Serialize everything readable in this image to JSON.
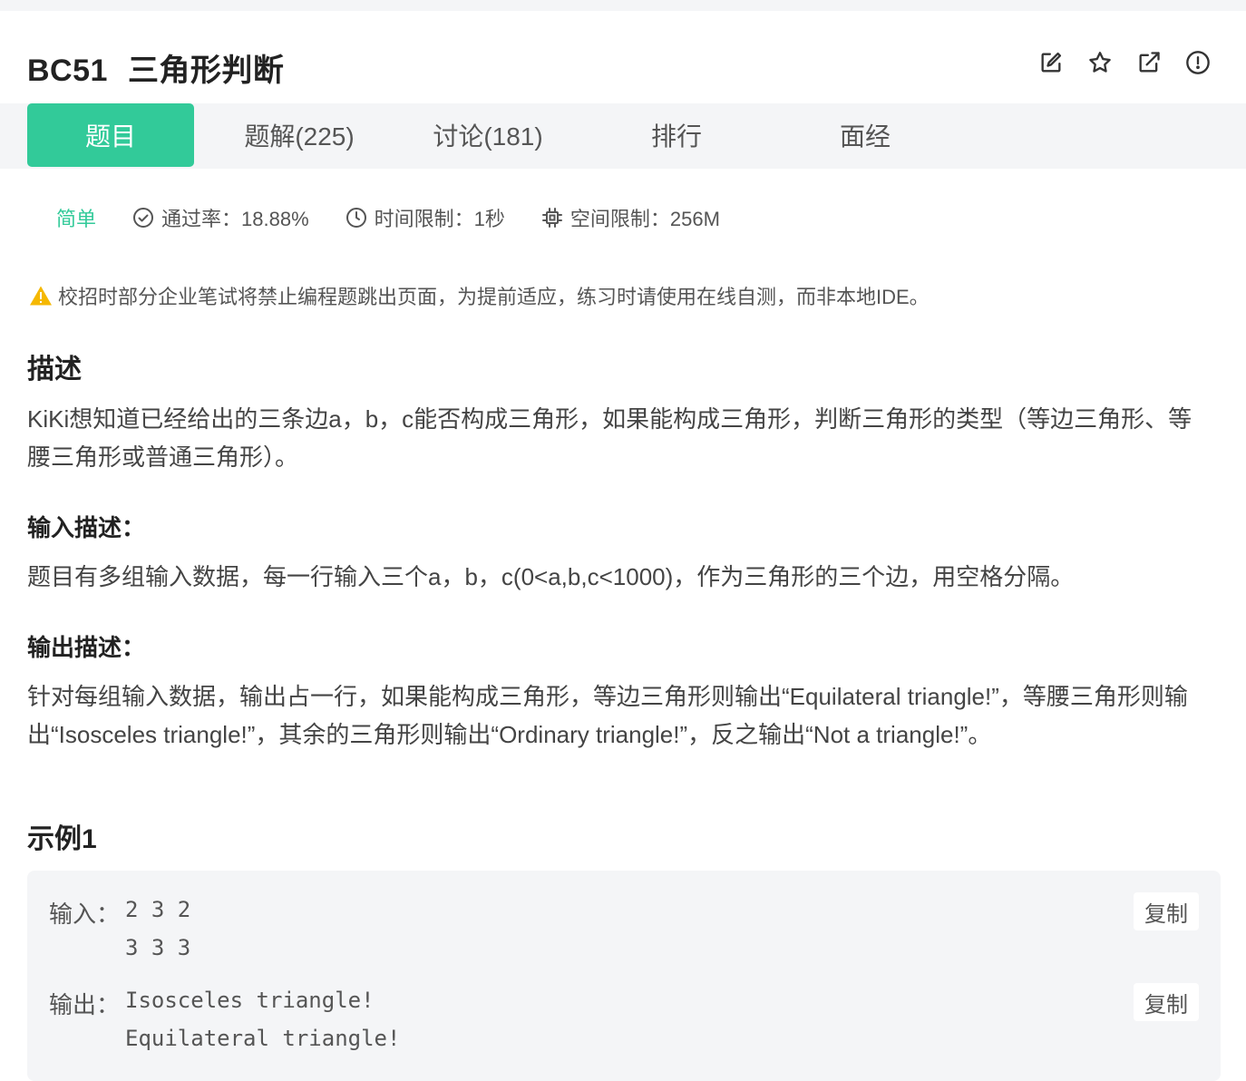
{
  "problem": {
    "code": "BC51",
    "title": "三角形判断"
  },
  "header_icons": [
    "edit-icon",
    "star-icon",
    "external-link-icon",
    "report-icon"
  ],
  "tabs": [
    {
      "label": "题目",
      "active": true
    },
    {
      "label": "题解(225)",
      "active": false
    },
    {
      "label": "讨论(181)",
      "active": false
    },
    {
      "label": "排行",
      "active": false
    },
    {
      "label": "面经",
      "active": false
    }
  ],
  "meta": {
    "difficulty": "简单",
    "pass_rate": "通过率：18.88%",
    "time_limit": "时间限制：1秒",
    "space_limit": "空间限制：256M"
  },
  "warning": "校招时部分企业笔试将禁止编程题跳出页面，为提前适应，练习时请使用在线自测，而非本地IDE。",
  "sections": {
    "description_title": "描述",
    "description_text": "KiKi想知道已经给出的三条边a，b，c能否构成三角形，如果能构成三角形，判断三角形的类型（等边三角形、等腰三角形或普通三角形）。",
    "input_title": "输入描述：",
    "input_text": "题目有多组输入数据，每一行输入三个a，b，c(0<a,b,c<1000)，作为三角形的三个边，用空格分隔。",
    "output_title": "输出描述：",
    "output_text": "针对每组输入数据，输出占一行，如果能构成三角形，等边三角形则输出“Equilateral triangle!”，等腰三角形则输出“Isosceles triangle!”，其余的三角形则输出“Ordinary triangle!”，反之输出“Not a triangle!”。"
  },
  "example": {
    "title": "示例1",
    "input_label": "输入：",
    "input_lines": [
      "2 3 2",
      "3 3 3"
    ],
    "output_label": "输出：",
    "output_lines": [
      "Isosceles triangle!",
      "Equilateral triangle!"
    ],
    "copy_label": "复制"
  },
  "colors": {
    "accent": "#32ca99",
    "warning": "#f5b800"
  }
}
